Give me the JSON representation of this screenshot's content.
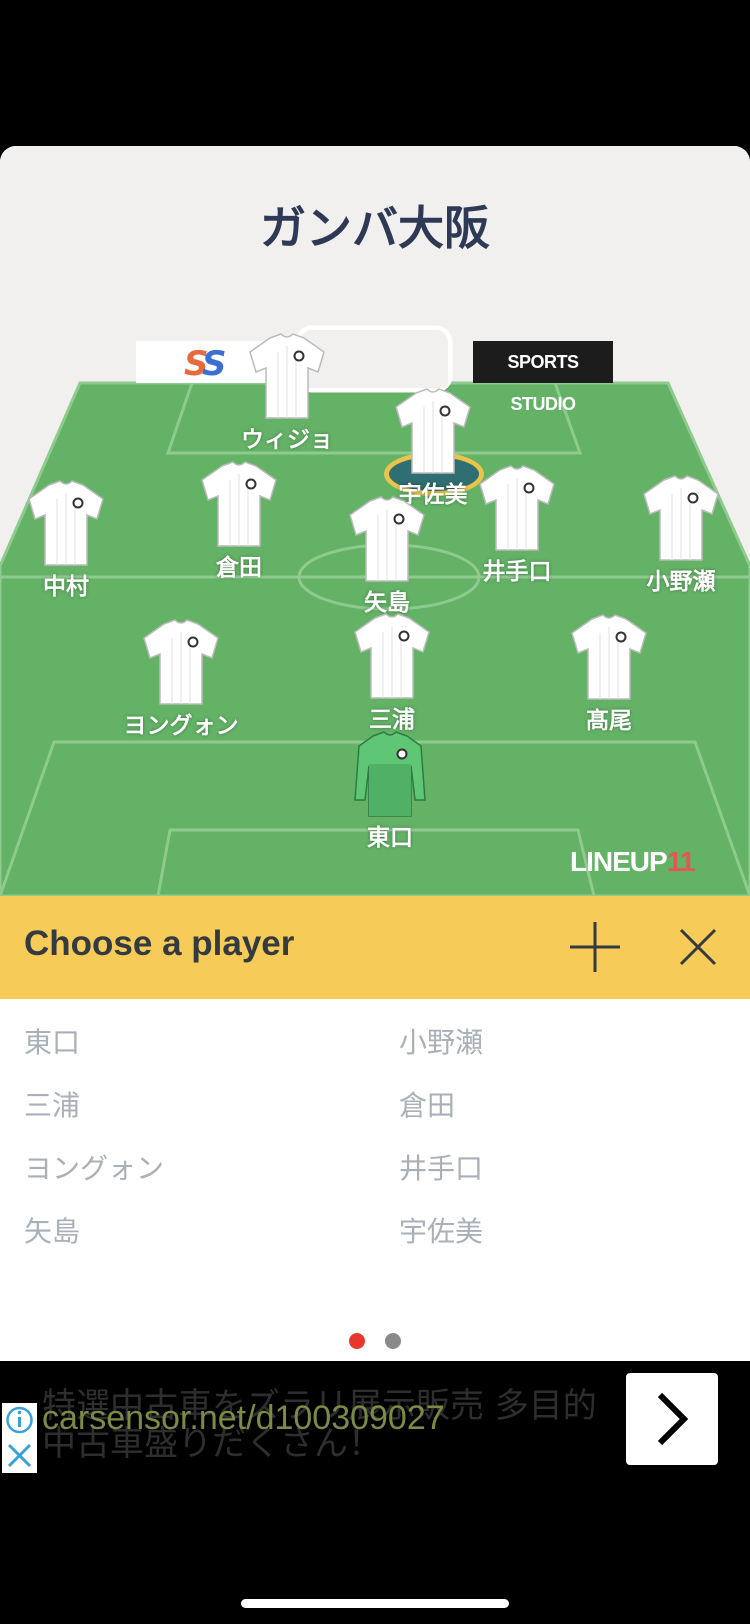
{
  "team": {
    "name": "ガンバ大阪"
  },
  "sponsors": {
    "right_label": "SPORTS STUDIO"
  },
  "brand": {
    "lineup_text": "LINEUP",
    "lineup_number": "11"
  },
  "colors": {
    "pitch": "#63b266",
    "pitch_lines": "#8fca8e",
    "chooser_bar": "#f6cb57",
    "dot_active": "#e8382e",
    "dot_inactive": "#8a8a8a",
    "captain_ring": "#e9c34a"
  },
  "formation": {
    "players": [
      {
        "name": "ウィジョ",
        "role": "forward"
      },
      {
        "name": "宇佐美",
        "role": "forward",
        "captain": true
      },
      {
        "name": "中村",
        "role": "midfielder"
      },
      {
        "name": "倉田",
        "role": "midfielder"
      },
      {
        "name": "矢島",
        "role": "midfielder"
      },
      {
        "name": "井手口",
        "role": "midfielder"
      },
      {
        "name": "小野瀬",
        "role": "midfielder"
      },
      {
        "name": "ヨングォン",
        "role": "defender"
      },
      {
        "name": "三浦",
        "role": "defender"
      },
      {
        "name": "髙尾",
        "role": "defender"
      },
      {
        "name": "東口",
        "role": "goalkeeper"
      }
    ]
  },
  "chooser": {
    "title": "Choose a player",
    "add_icon": "plus-icon",
    "close_icon": "close-icon",
    "left_column": [
      "東口",
      "三浦",
      "ヨングォン",
      "矢島"
    ],
    "right_column": [
      "小野瀬",
      "倉田",
      "井手口",
      "宇佐美"
    ]
  },
  "pagination": {
    "current_page": 1,
    "total_pages": 2
  },
  "ad": {
    "line1": "特選中古車をズラリ展示販売 多目的",
    "line2": "中古車盛りだくさん！",
    "url": "carsensor.net/d100309027",
    "info_icon": "info-icon",
    "close_icon": "close-icon",
    "arrow_icon": "chevron-right-icon"
  }
}
